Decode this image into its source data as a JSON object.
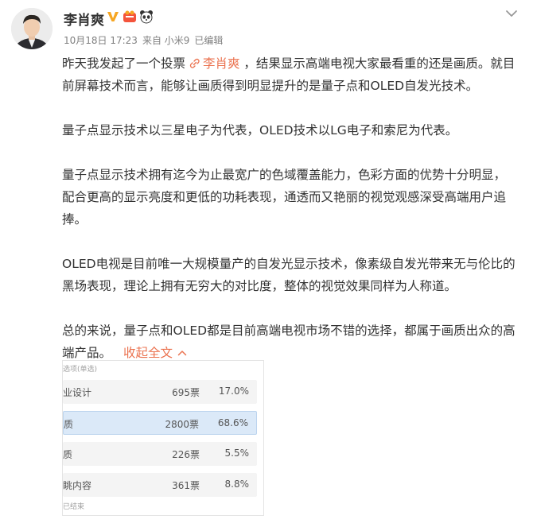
{
  "post": {
    "author": "李肖爽",
    "meta": {
      "date": "10月18日 17:23",
      "source": "来自 小米9",
      "edited": "已编辑"
    },
    "text": {
      "p1_prefix": "昨天我发起了一个投票",
      "mention": "李肖爽",
      "p1_suffix": "，结果显示高端电视大家最看重的还是画质。就目前屏幕技术而言，能够让画质得到明显提升的是量子点和OLED自发光技术。",
      "p2": "量子点显示技术以三星电子为代表，OLED技术以LG电子和索尼为代表。",
      "p3": "量子点显示技术拥有迄今为止最宽广的色域覆盖能力，色彩方面的优势十分明显，配合更高的显示亮度和更低的功耗表现，通透而又艳丽的视觉观感深受高端用户追捧。",
      "p4": "OLED电视是目前唯一大规模量产的自发光显示技术，像素级自发光带来无与伦比的黑场表现，理论上拥有无穷大的对比度，整体的视觉效果同样为人称道。",
      "p5": "总的来说，量子点和OLED都是目前高端电视市场不错的选择，都属于画质出众的高端产品。",
      "collapse_label": "收起全文"
    }
  },
  "poll": {
    "header": "选项(单选)",
    "options": [
      {
        "label": "业设计",
        "votes": "695票",
        "percent": "17.0%",
        "fraction": 0.17,
        "selected": false
      },
      {
        "label": "质",
        "votes": "2800票",
        "percent": "68.6%",
        "fraction": 0.686,
        "selected": true
      },
      {
        "label": "质",
        "votes": "226票",
        "percent": "5.5%",
        "fraction": 0.055,
        "selected": false
      },
      {
        "label": "眺内容",
        "votes": "361票",
        "percent": "8.8%",
        "fraction": 0.088,
        "selected": false
      }
    ],
    "footer": "已结束"
  },
  "colors": {
    "accent": "#eb7350",
    "poll_highlight": "#dbe9f8",
    "vip": "#f6a623"
  },
  "icons": {
    "header_more": "chevron-down-icon",
    "badges": [
      "verified-v-icon",
      "vip-icon",
      "panda-icon"
    ],
    "mention": "link-icon",
    "collapse": "chevron-up-icon"
  }
}
